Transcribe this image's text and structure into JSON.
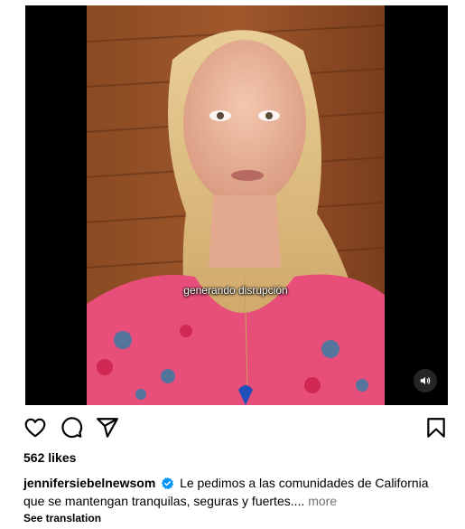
{
  "post": {
    "video": {
      "subtitle": "generando disrupción",
      "sound_icon": "speaker-icon"
    },
    "actions": {
      "like_icon": "heart-icon",
      "comment_icon": "comment-icon",
      "share_icon": "send-icon",
      "save_icon": "bookmark-icon"
    },
    "likes": "562 likes",
    "caption": {
      "username": "jennifersiebelnewsom",
      "verified_icon": "verified-badge-icon",
      "text": "Le pedimos a las comunidades de California que se mantengan tranquilas, seguras y fuertes....",
      "more_label": "more"
    },
    "see_translation": "See translation"
  },
  "colors": {
    "verified_blue": "#0095f6",
    "secondary_text": "#737373",
    "media_bg": "#000000"
  }
}
